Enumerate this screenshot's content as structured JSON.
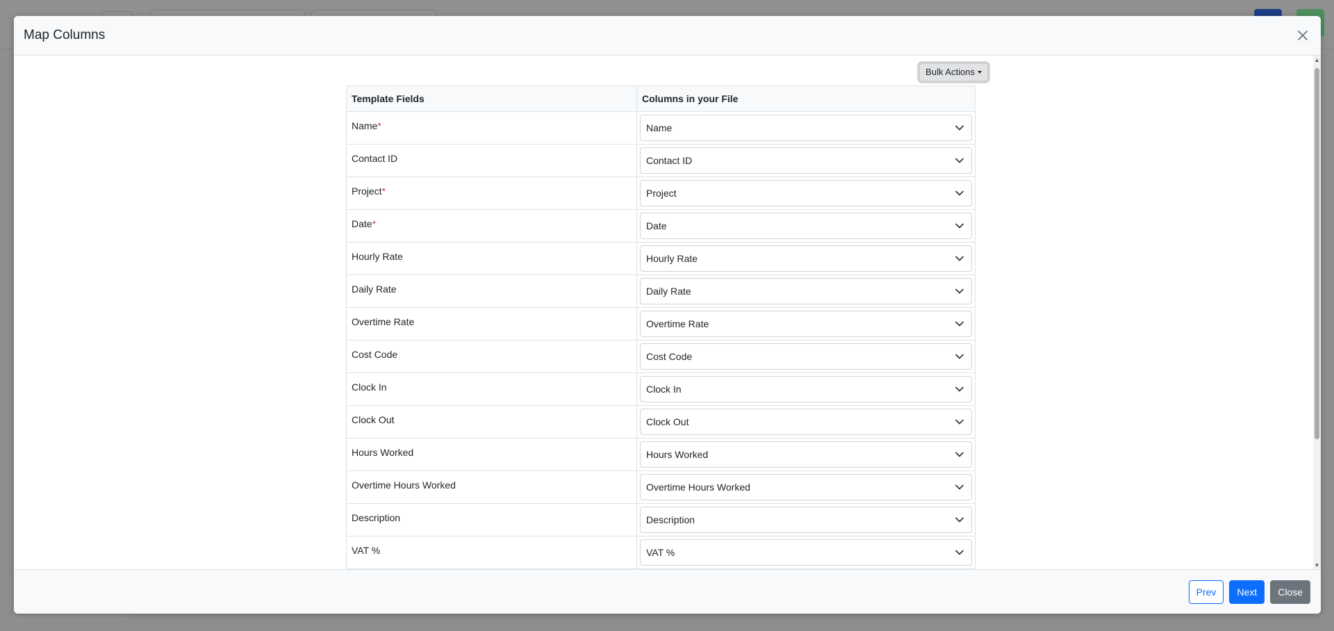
{
  "modal": {
    "title": "Map Columns",
    "bulk_actions_label": "Bulk Actions",
    "table": {
      "headers": [
        "Template Fields",
        "Columns in your File"
      ],
      "rows": [
        {
          "field": "Name",
          "required": "*",
          "value": "Name"
        },
        {
          "field": "Contact ID",
          "required": "",
          "value": "Contact ID"
        },
        {
          "field": "Project",
          "required": "*",
          "value": "Project"
        },
        {
          "field": "Date",
          "required": "*",
          "value": "Date"
        },
        {
          "field": "Hourly Rate",
          "required": "",
          "value": "Hourly Rate"
        },
        {
          "field": "Daily Rate",
          "required": "",
          "value": "Daily Rate"
        },
        {
          "field": "Overtime Rate",
          "required": "",
          "value": "Overtime Rate"
        },
        {
          "field": "Cost Code",
          "required": "",
          "value": "Cost Code"
        },
        {
          "field": "Clock In",
          "required": "",
          "value": "Clock In"
        },
        {
          "field": "Clock Out",
          "required": "",
          "value": "Clock Out"
        },
        {
          "field": "Hours Worked",
          "required": "",
          "value": "Hours Worked"
        },
        {
          "field": "Overtime Hours Worked",
          "required": "",
          "value": "Overtime Hours Worked"
        },
        {
          "field": "Description",
          "required": "",
          "value": "Description"
        },
        {
          "field": "VAT %",
          "required": "",
          "value": "VAT %"
        },
        {
          "field": "",
          "required": "",
          "value": ""
        }
      ]
    },
    "footer": {
      "prev_label": "Prev",
      "next_label": "Next",
      "close_label": "Close"
    },
    "icons": {
      "close": "close-icon",
      "select_arrow": "chevron-down-icon"
    }
  },
  "colors": {
    "primary": "#0d6efd",
    "secondary": "#6c757d",
    "required": "#dc3545"
  }
}
